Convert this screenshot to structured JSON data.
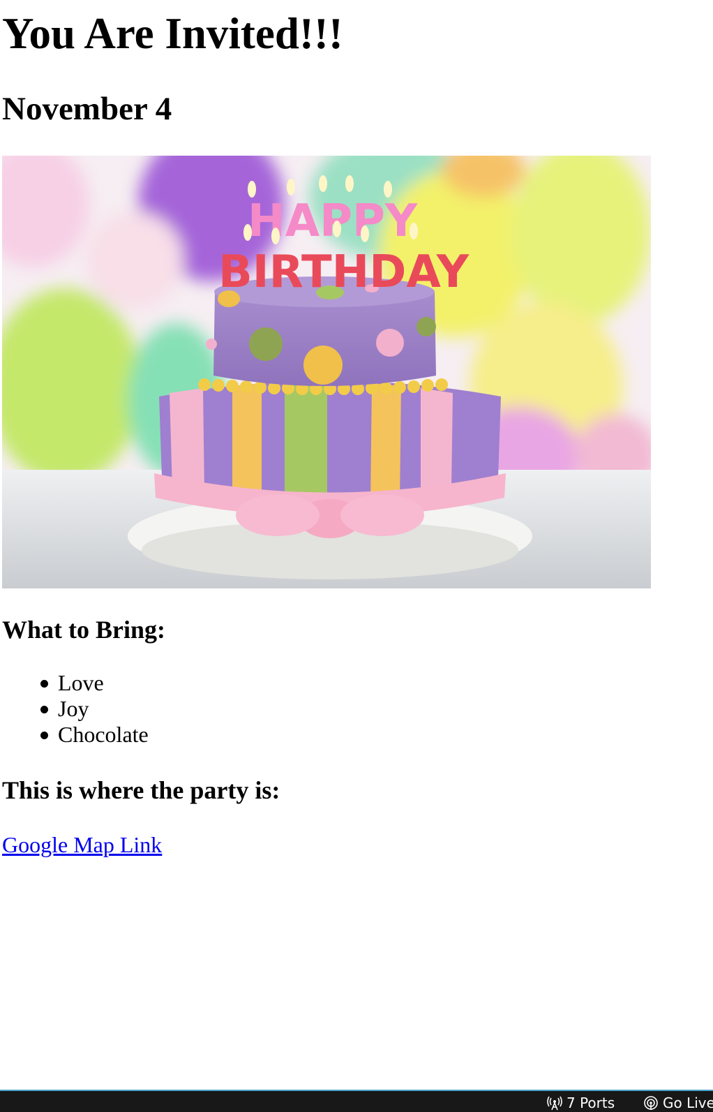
{
  "invitation": {
    "title": "You Are Invited!!!",
    "date": "November 4",
    "image": {
      "description_icon": "birthday-cake-image",
      "cake_topper_line1": "HAPPY",
      "cake_topper_line2": "BIRTHDAY"
    },
    "bring_heading": "What to Bring:",
    "bring_items": [
      "Love",
      "Joy",
      "Chocolate"
    ],
    "party_heading": "This is where the party is:",
    "map_link_label": "Google Map Link"
  },
  "status_bar": {
    "ports_label": "7 Ports",
    "ports_icon": "broadcast-icon",
    "golive_label": "Go Live",
    "golive_icon": "radio-tower-icon"
  },
  "colors": {
    "link": "#0000ee",
    "status_bar_bg": "#181818",
    "status_bar_border": "#4aa0c8"
  }
}
